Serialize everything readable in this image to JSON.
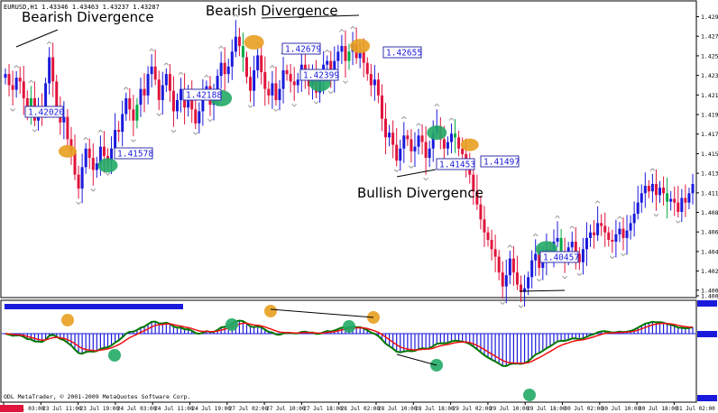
{
  "window": {
    "symbol_header": "EURUSD,H1  1.43346 1.43463 1.43237 1.43287",
    "copyright": "ODL MetaTrader, © 2001-2009 MetaQuotes Software Corp."
  },
  "annotations": {
    "bearish_1": "Bearish Divergence",
    "bearish_2": "Bearish Divergence",
    "bullish": "Bullish Divergence"
  },
  "price_labels": [
    "1.42020",
    "1.41578",
    "1.42188",
    "1.42679",
    "1.42399",
    "1.42655",
    "1.41453",
    "1.41497",
    "1.40457"
  ],
  "colors": {
    "up_candle": "#1a1adc",
    "down_candle": "#e0143c",
    "neutral_candle": "#00aa44",
    "signal_orange": "#e8a020",
    "signal_green": "#22aa66",
    "histogram": "#1a1adc",
    "ma_green": "#007700",
    "ma_red": "#ee1111",
    "current_price_tag": "#e0143c"
  },
  "chart_data": {
    "type": "candlestick",
    "price_axis": {
      "ylim": [
        1.4,
        1.43
      ],
      "ticks": [
        "1.42995",
        "1.42785",
        "1.42575",
        "1.42365",
        "1.42155",
        "1.41945",
        "1.41735",
        "1.41525",
        "1.41315",
        "1.41105",
        "1.40895",
        "1.40685",
        "1.40475",
        "1.40265",
        "1.40060",
        "1.40000"
      ]
    },
    "time_axis": {
      "ticks": [
        "23 Jul 03:00",
        "23 Jul 11:00",
        "23 Jul 19:00",
        "24 Jul 03:00",
        "24 Jul 11:00",
        "24 Jul 19:00",
        "27 Jul 02:00",
        "27 Jul 10:00",
        "27 Jul 18:00",
        "28 Jul 02:00",
        "28 Jul 10:00",
        "28 Jul 18:00",
        "29 Jul 02:00",
        "29 Jul 10:00",
        "29 Jul 18:00",
        "30 Jul 02:00",
        "30 Jul 10:00",
        "30 Jul 18:00",
        "31 Jul 02:00"
      ]
    },
    "series": [
      {
        "name": "EURUSD,H1",
        "close": [
          1.4238,
          1.4226,
          1.4221,
          1.4234,
          1.423,
          1.4212,
          1.4198,
          1.4212,
          1.4188,
          1.4203,
          1.4198,
          1.4228,
          1.4256,
          1.423,
          1.4202,
          1.4186,
          1.4192,
          1.4168,
          1.4155,
          1.413,
          1.4115,
          1.4138,
          1.4158,
          1.4148,
          1.4135,
          1.4142,
          1.416,
          1.415,
          1.4145,
          1.4158,
          1.4178,
          1.4176,
          1.4195,
          1.4212,
          1.42,
          1.4188,
          1.4205,
          1.4222,
          1.4215,
          1.4238,
          1.4246,
          1.4232,
          1.421,
          1.4226,
          1.4238,
          1.422,
          1.4198,
          1.421,
          1.4222,
          1.4202,
          1.4218,
          1.42,
          1.4185,
          1.4198,
          1.4218,
          1.4225,
          1.4205,
          1.4212,
          1.4236,
          1.425,
          1.4238,
          1.4246,
          1.4262,
          1.4278,
          1.4268,
          1.4256,
          1.4235,
          1.422,
          1.4242,
          1.4258,
          1.424,
          1.4222,
          1.4215,
          1.4228,
          1.421,
          1.4222,
          1.4242,
          1.4238,
          1.423,
          1.4226,
          1.4232,
          1.4248,
          1.424,
          1.4225,
          1.4235,
          1.4218,
          1.4232,
          1.4248,
          1.4252,
          1.4235,
          1.4252,
          1.4262,
          1.4268,
          1.4252,
          1.4262,
          1.427,
          1.4255,
          1.4262,
          1.425,
          1.4238,
          1.4226,
          1.4232,
          1.4215,
          1.419,
          1.417,
          1.4175,
          1.4162,
          1.4145,
          1.4158,
          1.4172,
          1.4168,
          1.4155,
          1.416,
          1.4172,
          1.4165,
          1.4148,
          1.4158,
          1.4175,
          1.4182,
          1.4168,
          1.4158,
          1.4165,
          1.4174,
          1.417,
          1.4158,
          1.4152,
          1.4145,
          1.413,
          1.4112,
          1.4098,
          1.4082,
          1.4068,
          1.406,
          1.405,
          1.4042,
          1.4025,
          1.401,
          1.4022,
          1.404,
          1.4025,
          1.4012,
          1.4004,
          1.4008,
          1.402,
          1.4038,
          1.4045,
          1.403,
          1.404,
          1.405,
          1.4045,
          1.4058,
          1.4062,
          1.4048,
          1.404,
          1.4052,
          1.4058,
          1.4045,
          1.4036,
          1.405,
          1.4062,
          1.4068,
          1.4065,
          1.4078,
          1.4075,
          1.4068,
          1.406,
          1.4058,
          1.4066,
          1.4072,
          1.4062,
          1.407,
          1.4078,
          1.4088,
          1.41,
          1.411,
          1.4118,
          1.4112,
          1.412,
          1.4108,
          1.4116,
          1.411,
          1.4101,
          1.4104,
          1.41,
          1.409,
          1.4105,
          1.41,
          1.411,
          1.412
        ]
      },
      {
        "name": "MACD histogram"
      },
      {
        "name": "fast line"
      },
      {
        "name": "slow line"
      }
    ],
    "divergence_lines": [
      {
        "label": "Bearish Divergence",
        "from": [
          1.4232,
          "23 Jul 03:00"
        ],
        "to": [
          1.429,
          "23 Jul 11:00"
        ]
      },
      {
        "label": "Bearish Divergence",
        "from": [
          1.429,
          "27 Jul 10:00"
        ],
        "to": [
          1.4294,
          "28 Jul 02:00"
        ]
      },
      {
        "label": "Bullish Divergence",
        "from": [
          1.4122,
          "28 Jul 18:00"
        ],
        "to": [
          1.4138,
          "29 Jul 02:00"
        ]
      },
      {
        "label": "Bullish Divergence",
        "from": [
          1.4008,
          "29 Jul 10:00"
        ],
        "to": [
          1.4008,
          "30 Jul 02:00"
        ]
      }
    ]
  }
}
